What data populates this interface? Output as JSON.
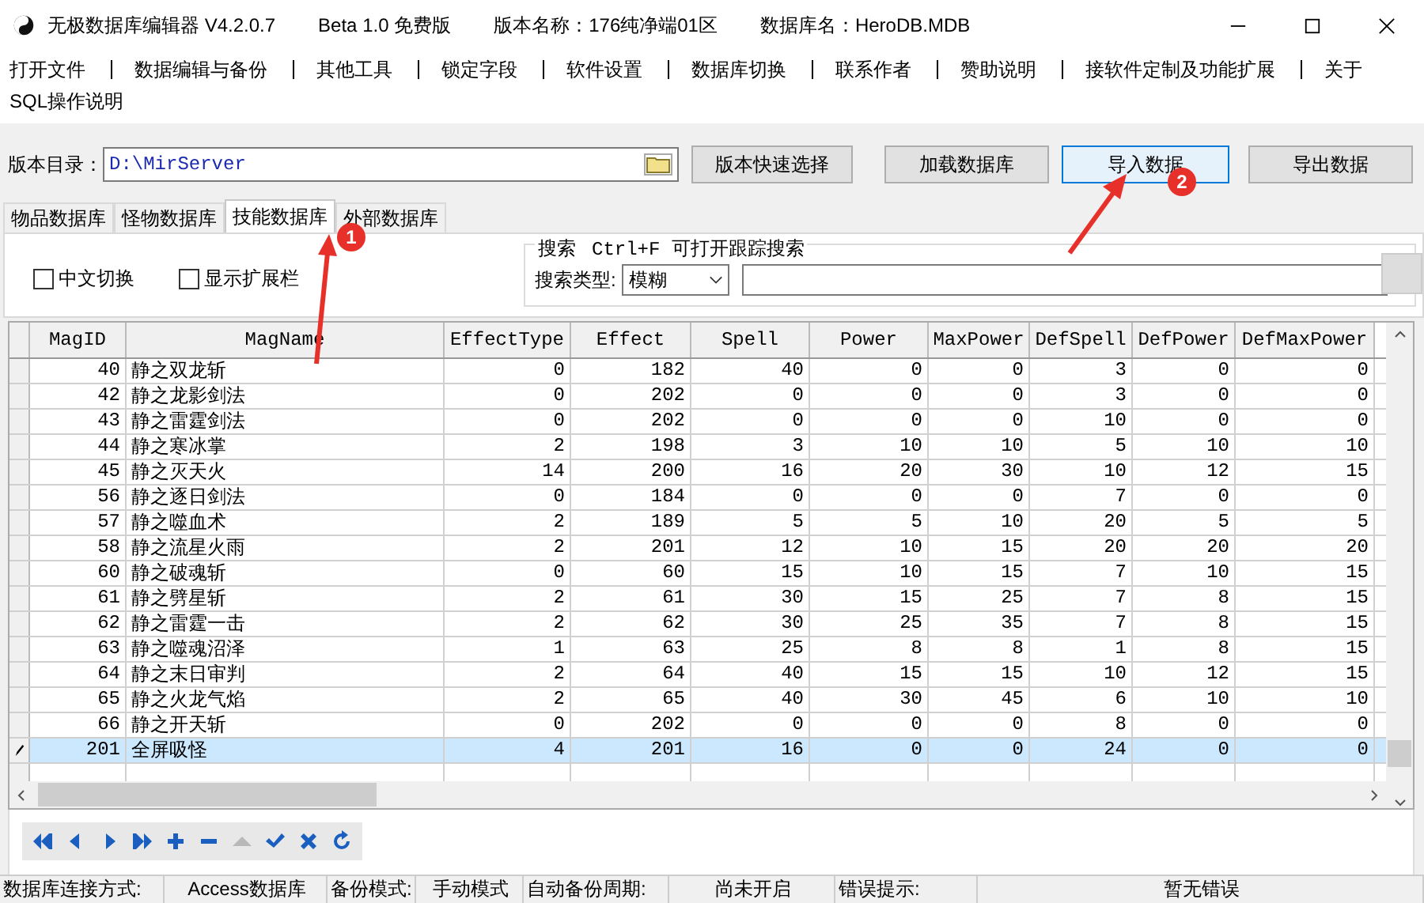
{
  "window": {
    "title_parts": [
      "无极数据库编辑器 V4.2.0.7",
      "Beta 1.0 免费版",
      "版本名称：176纯净端01区",
      "数据库名：HeroDB.MDB"
    ]
  },
  "menu": [
    "打开文件",
    "数据编辑与备份",
    "其他工具",
    "锁定字段",
    "软件设置",
    "数据库切换",
    "联系作者",
    "赞助说明",
    "接软件定制及功能扩展",
    "关于",
    "SQL操作说明"
  ],
  "toolbar": {
    "path_label": "版本目录：",
    "path_value": "D:\\MirServer",
    "buttons": [
      {
        "label": "版本快速选择",
        "selected": false
      },
      {
        "label": "加载数据库",
        "selected": false
      },
      {
        "label": "导入数据",
        "selected": true
      },
      {
        "label": "导出数据",
        "selected": false
      }
    ]
  },
  "tabs": [
    {
      "label": "物品数据库",
      "selected": false
    },
    {
      "label": "怪物数据库",
      "selected": false
    },
    {
      "label": "技能数据库",
      "selected": true
    },
    {
      "label": "外部数据库",
      "selected": false
    }
  ],
  "options": [
    {
      "label": "中文切换",
      "checked": false
    },
    {
      "label": "显示扩展栏",
      "checked": false
    }
  ],
  "search": {
    "title": "搜索",
    "hint": "Ctrl+F 可打开跟踪搜索",
    "type_label": "搜索类型:",
    "type_value": "模糊"
  },
  "table": {
    "columns": [
      "MagID",
      "MagName",
      "EffectType",
      "Effect",
      "Spell",
      "Power",
      "MaxPower",
      "DefSpell",
      "DefPower",
      "DefMaxPower"
    ],
    "rows": [
      {
        "cells": [
          "40",
          "静之双龙斩",
          "0",
          "182",
          "40",
          "0",
          "0",
          "3",
          "0",
          "0"
        ],
        "selected": false
      },
      {
        "cells": [
          "42",
          "静之龙影剑法",
          "0",
          "202",
          "0",
          "0",
          "0",
          "3",
          "0",
          "0"
        ],
        "selected": false
      },
      {
        "cells": [
          "43",
          "静之雷霆剑法",
          "0",
          "202",
          "0",
          "0",
          "0",
          "10",
          "0",
          "0"
        ],
        "selected": false
      },
      {
        "cells": [
          "44",
          "静之寒冰掌",
          "2",
          "198",
          "3",
          "10",
          "10",
          "5",
          "10",
          "10"
        ],
        "selected": false
      },
      {
        "cells": [
          "45",
          "静之灭天火",
          "14",
          "200",
          "16",
          "20",
          "30",
          "10",
          "12",
          "15"
        ],
        "selected": false
      },
      {
        "cells": [
          "56",
          "静之逐日剑法",
          "0",
          "184",
          "0",
          "0",
          "0",
          "7",
          "0",
          "0"
        ],
        "selected": false
      },
      {
        "cells": [
          "57",
          "静之噬血术",
          "2",
          "189",
          "5",
          "5",
          "10",
          "20",
          "5",
          "5"
        ],
        "selected": false
      },
      {
        "cells": [
          "58",
          "静之流星火雨",
          "2",
          "201",
          "12",
          "10",
          "15",
          "20",
          "20",
          "20"
        ],
        "selected": false
      },
      {
        "cells": [
          "60",
          "静之破魂斩",
          "0",
          "60",
          "15",
          "10",
          "15",
          "7",
          "10",
          "15"
        ],
        "selected": false
      },
      {
        "cells": [
          "61",
          "静之劈星斩",
          "2",
          "61",
          "30",
          "15",
          "25",
          "7",
          "8",
          "15"
        ],
        "selected": false
      },
      {
        "cells": [
          "62",
          "静之雷霆一击",
          "2",
          "62",
          "30",
          "25",
          "35",
          "7",
          "8",
          "15"
        ],
        "selected": false
      },
      {
        "cells": [
          "63",
          "静之噬魂沼泽",
          "1",
          "63",
          "25",
          "8",
          "8",
          "1",
          "8",
          "15"
        ],
        "selected": false
      },
      {
        "cells": [
          "64",
          "静之末日审判",
          "2",
          "64",
          "40",
          "15",
          "15",
          "10",
          "12",
          "15"
        ],
        "selected": false
      },
      {
        "cells": [
          "65",
          "静之火龙气焰",
          "2",
          "65",
          "40",
          "30",
          "45",
          "6",
          "10",
          "10"
        ],
        "selected": false
      },
      {
        "cells": [
          "66",
          "静之开天斩",
          "0",
          "202",
          "0",
          "0",
          "0",
          "8",
          "0",
          "0"
        ],
        "selected": false
      },
      {
        "cells": [
          "201",
          "全屏吸怪",
          "4",
          "201",
          "16",
          "0",
          "0",
          "24",
          "0",
          "0"
        ],
        "selected": true
      }
    ]
  },
  "navigator": [
    {
      "kind": "first",
      "disabled": false
    },
    {
      "kind": "prior",
      "disabled": false
    },
    {
      "kind": "next",
      "disabled": false
    },
    {
      "kind": "last",
      "disabled": false
    },
    {
      "kind": "insert",
      "disabled": false
    },
    {
      "kind": "delete",
      "disabled": false
    },
    {
      "kind": "edit",
      "disabled": true
    },
    {
      "kind": "post",
      "disabled": false
    },
    {
      "kind": "cancel",
      "disabled": false
    },
    {
      "kind": "refresh",
      "disabled": false
    }
  ],
  "status_bar": [
    "数据库连接方式:",
    "Access数据库",
    "备份模式:",
    "手动模式",
    "自动备份周期:",
    "尚未开启",
    "错误提示:",
    "暂无错误"
  ],
  "annotations": [
    "1",
    "2"
  ]
}
